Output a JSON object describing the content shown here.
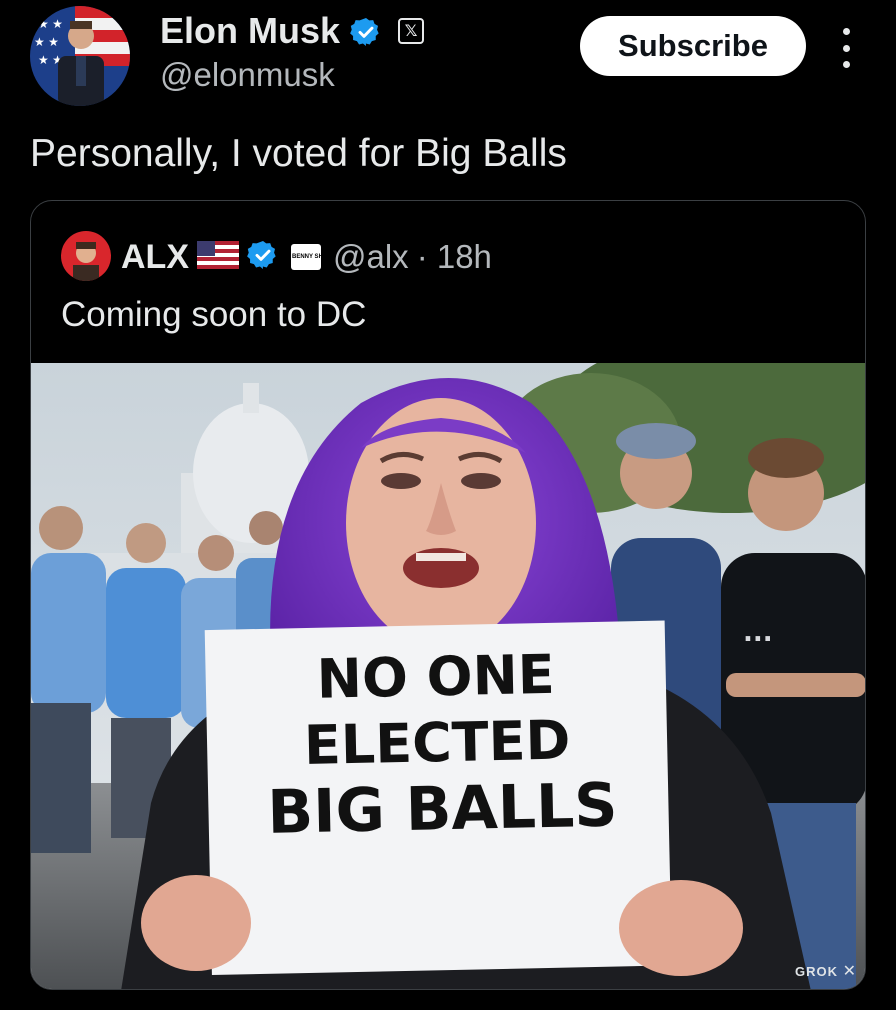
{
  "post": {
    "author_name": "Elon Musk",
    "author_handle": "@elonmusk",
    "platform_badge": "𝕏",
    "subscribe_label": "Subscribe",
    "text": "Personally, I voted for Big Balls"
  },
  "quoted_post": {
    "author_name": "ALX",
    "author_handle": "@alx",
    "time": "· 18h",
    "affiliate_badge": "BENNY SHOW",
    "text": "Coming soon to DC",
    "image": {
      "sign_lines": [
        "NO ONE",
        "ELECTED",
        "BIG BALLS"
      ],
      "shirt_text": "...",
      "watermark": "GROK"
    }
  },
  "colors": {
    "background": "#000000",
    "text": "#e7e9ea",
    "secondary_text": "#b4b8bc",
    "verified_blue": "#1d9bf0",
    "border": "#3b3f43"
  }
}
